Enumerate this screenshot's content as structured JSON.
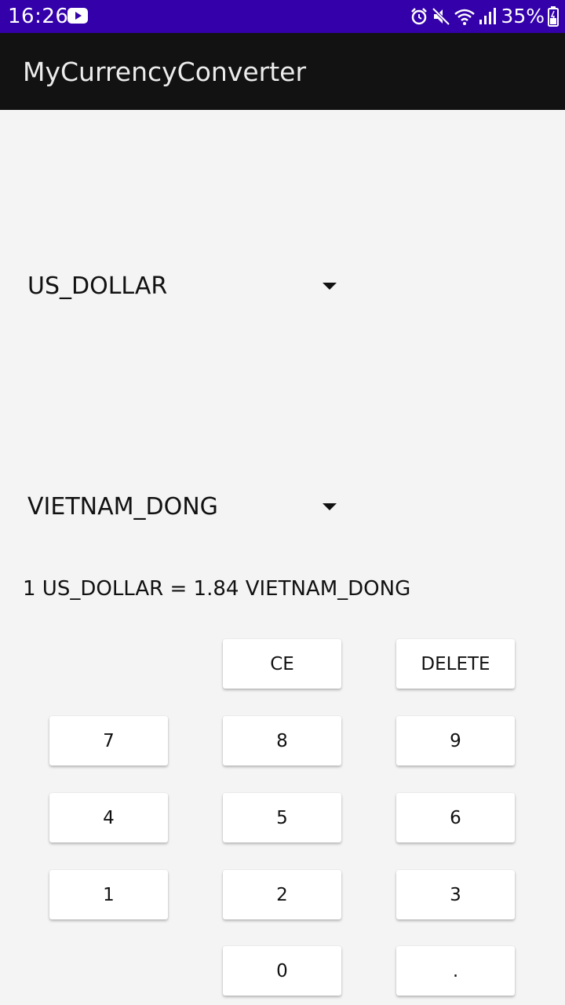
{
  "status_bar": {
    "time": "16:26",
    "battery": "35%",
    "icons": [
      "youtube-icon",
      "alarm-icon",
      "mute-icon",
      "wifi-icon",
      "signal-icon",
      "battery-icon"
    ]
  },
  "app_bar": {
    "title": "MyCurrencyConverter"
  },
  "from_currency": {
    "selected": "US_DOLLAR"
  },
  "to_currency": {
    "selected": "VIETNAM_DONG"
  },
  "conversion": {
    "rate_text": "1 US_DOLLAR = 1.84 VIETNAM_DONG"
  },
  "keypad": {
    "ce": "CE",
    "delete": "DELETE",
    "k7": "7",
    "k8": "8",
    "k9": "9",
    "k4": "4",
    "k5": "5",
    "k6": "6",
    "k1": "1",
    "k2": "2",
    "k3": "3",
    "k0": "0",
    "dot": "."
  },
  "colors": {
    "status_bar": "#3300aa",
    "app_bar": "#121212",
    "background": "#f4f4f4",
    "key_background": "#ffffff"
  }
}
